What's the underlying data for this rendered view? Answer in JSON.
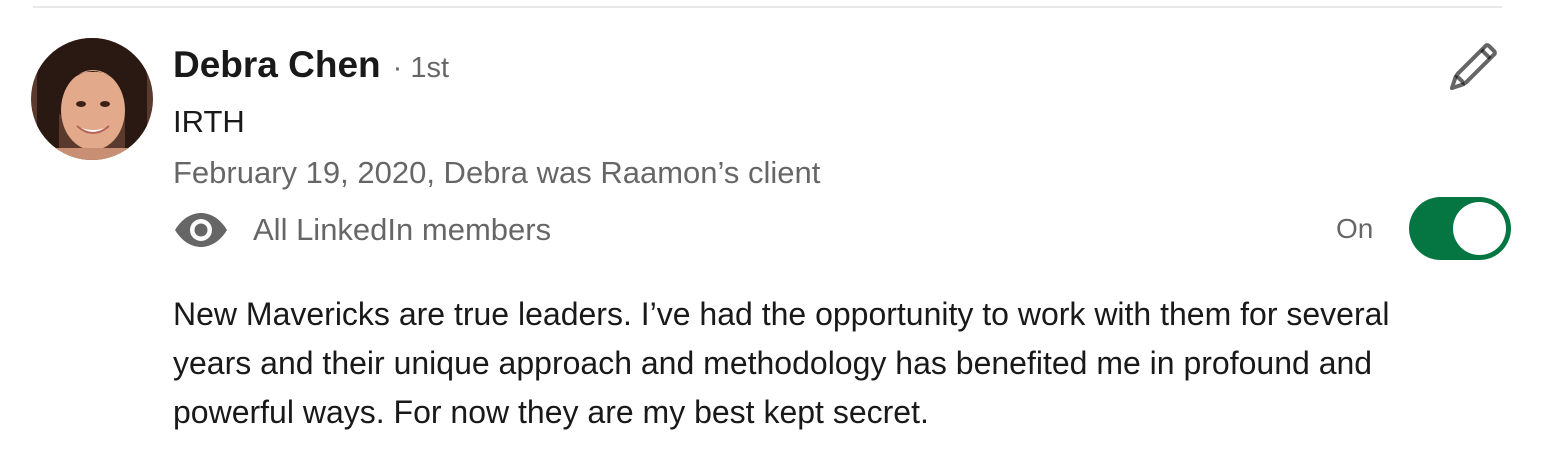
{
  "recommendation_card": {
    "author": {
      "name": "Debra Chen",
      "degree": "· 1st",
      "company": "IRTH",
      "avatar_icon": "profile-photo"
    },
    "meta": "February 19, 2020, Debra was Raamon’s client",
    "visibility": {
      "icon": "eye-icon",
      "label": "All LinkedIn members"
    },
    "edit_icon": "pencil-icon",
    "toggle": {
      "label": "On",
      "state": "on",
      "color": "#057642"
    },
    "text": "New Mavericks are true leaders. I’ve had the opportunity to work with them for several years and their unique approach and methodology has benefited me in profound and powerful ways. For now they are my best kept secret."
  }
}
